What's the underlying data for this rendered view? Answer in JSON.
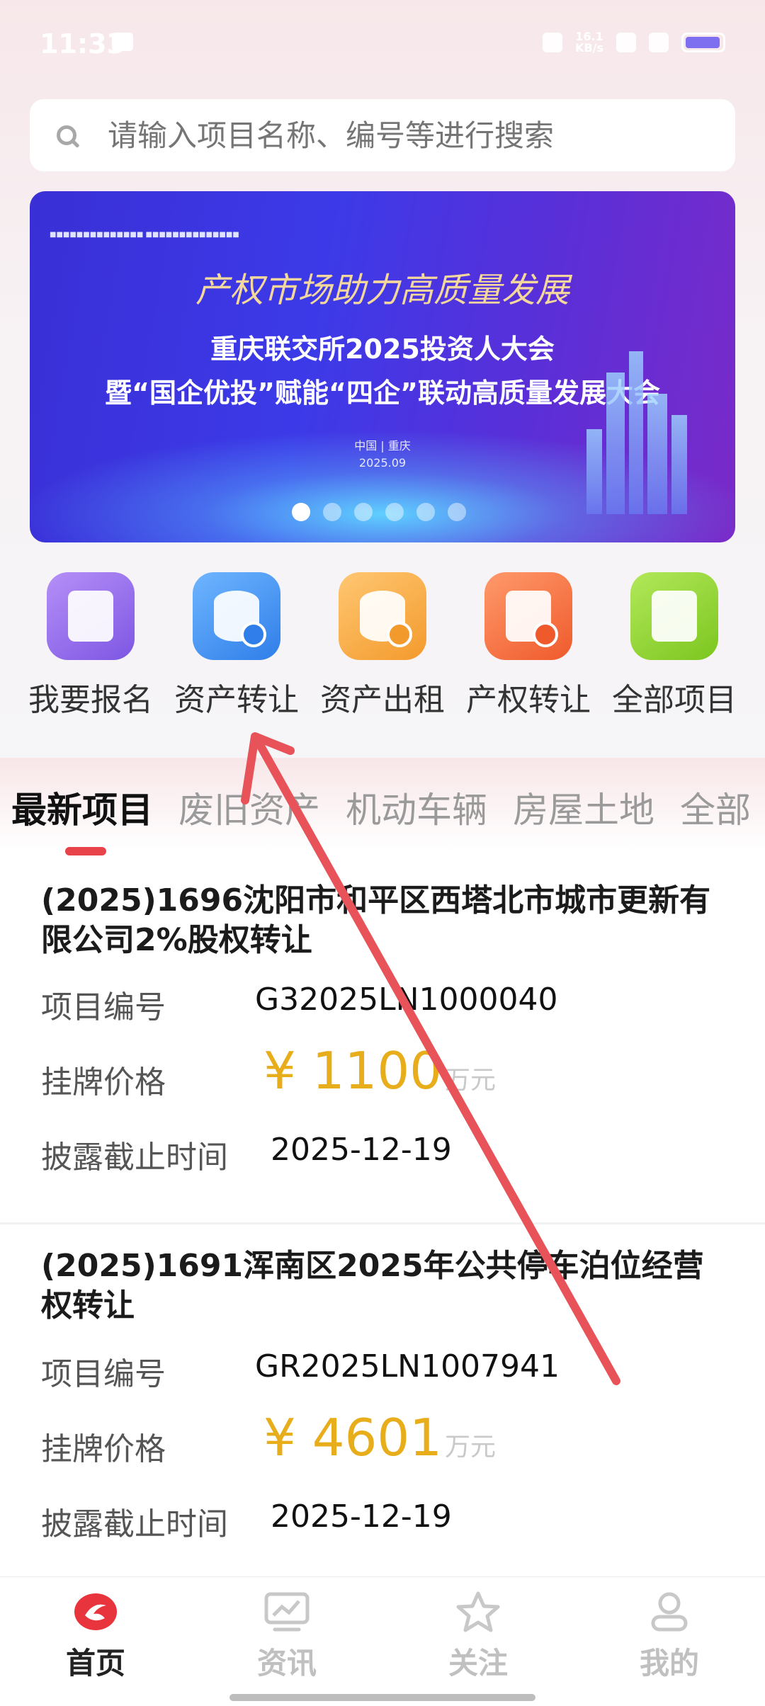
{
  "status_bar": {
    "time": "11:33",
    "speed": "16.1\nKB/s"
  },
  "search": {
    "placeholder": "请输入项目名称、编号等进行搜索"
  },
  "banner": {
    "slogan": "产权市场助力高质量发展",
    "title_line1": "重庆联交所2025投资人大会",
    "title_line2": "暨“国企优投”赋能“四企”联动高质量发展大会",
    "place": "中国 | 重庆",
    "date": "2025.09",
    "slide_count": 6,
    "active_slide": 1
  },
  "quick_actions": [
    {
      "label": "我要报名",
      "icon": "register-edit-icon",
      "color": "#8a63e8"
    },
    {
      "label": "资产转让",
      "icon": "asset-transfer-icon",
      "color": "#3d8ff2"
    },
    {
      "label": "资产出租",
      "icon": "asset-rent-icon",
      "color": "#f5a33b"
    },
    {
      "label": "产权转让",
      "icon": "property-transfer-icon",
      "color": "#f36a3a"
    },
    {
      "label": "全部项目",
      "icon": "all-projects-icon",
      "color": "#8ccc2e"
    }
  ],
  "tabs": [
    "最新项目",
    "废旧资产",
    "机动车辆",
    "房屋土地",
    "全部"
  ],
  "active_tab": "最新项目",
  "labels": {
    "project_no": "项目编号",
    "price": "挂牌价格",
    "deadline": "披露截止时间",
    "currency": "¥",
    "unit": "万元"
  },
  "projects": [
    {
      "title": "(2025)1696沈阳市和平区西塔北市城市更新有限公司2%股权转让",
      "project_no": "G32025LN1000040",
      "price": "1100",
      "deadline": "2025-12-19"
    },
    {
      "title": "(2025)1691浑南区2025年公共停车泊位经营权转让",
      "project_no": "GR2025LN1007941",
      "price": "4601",
      "deadline": "2025-12-19"
    }
  ],
  "bottom_nav": [
    "首页",
    "资讯",
    "关注",
    "我的"
  ],
  "colors": {
    "accent": "#e8434b",
    "price": "#e7ad1b"
  }
}
